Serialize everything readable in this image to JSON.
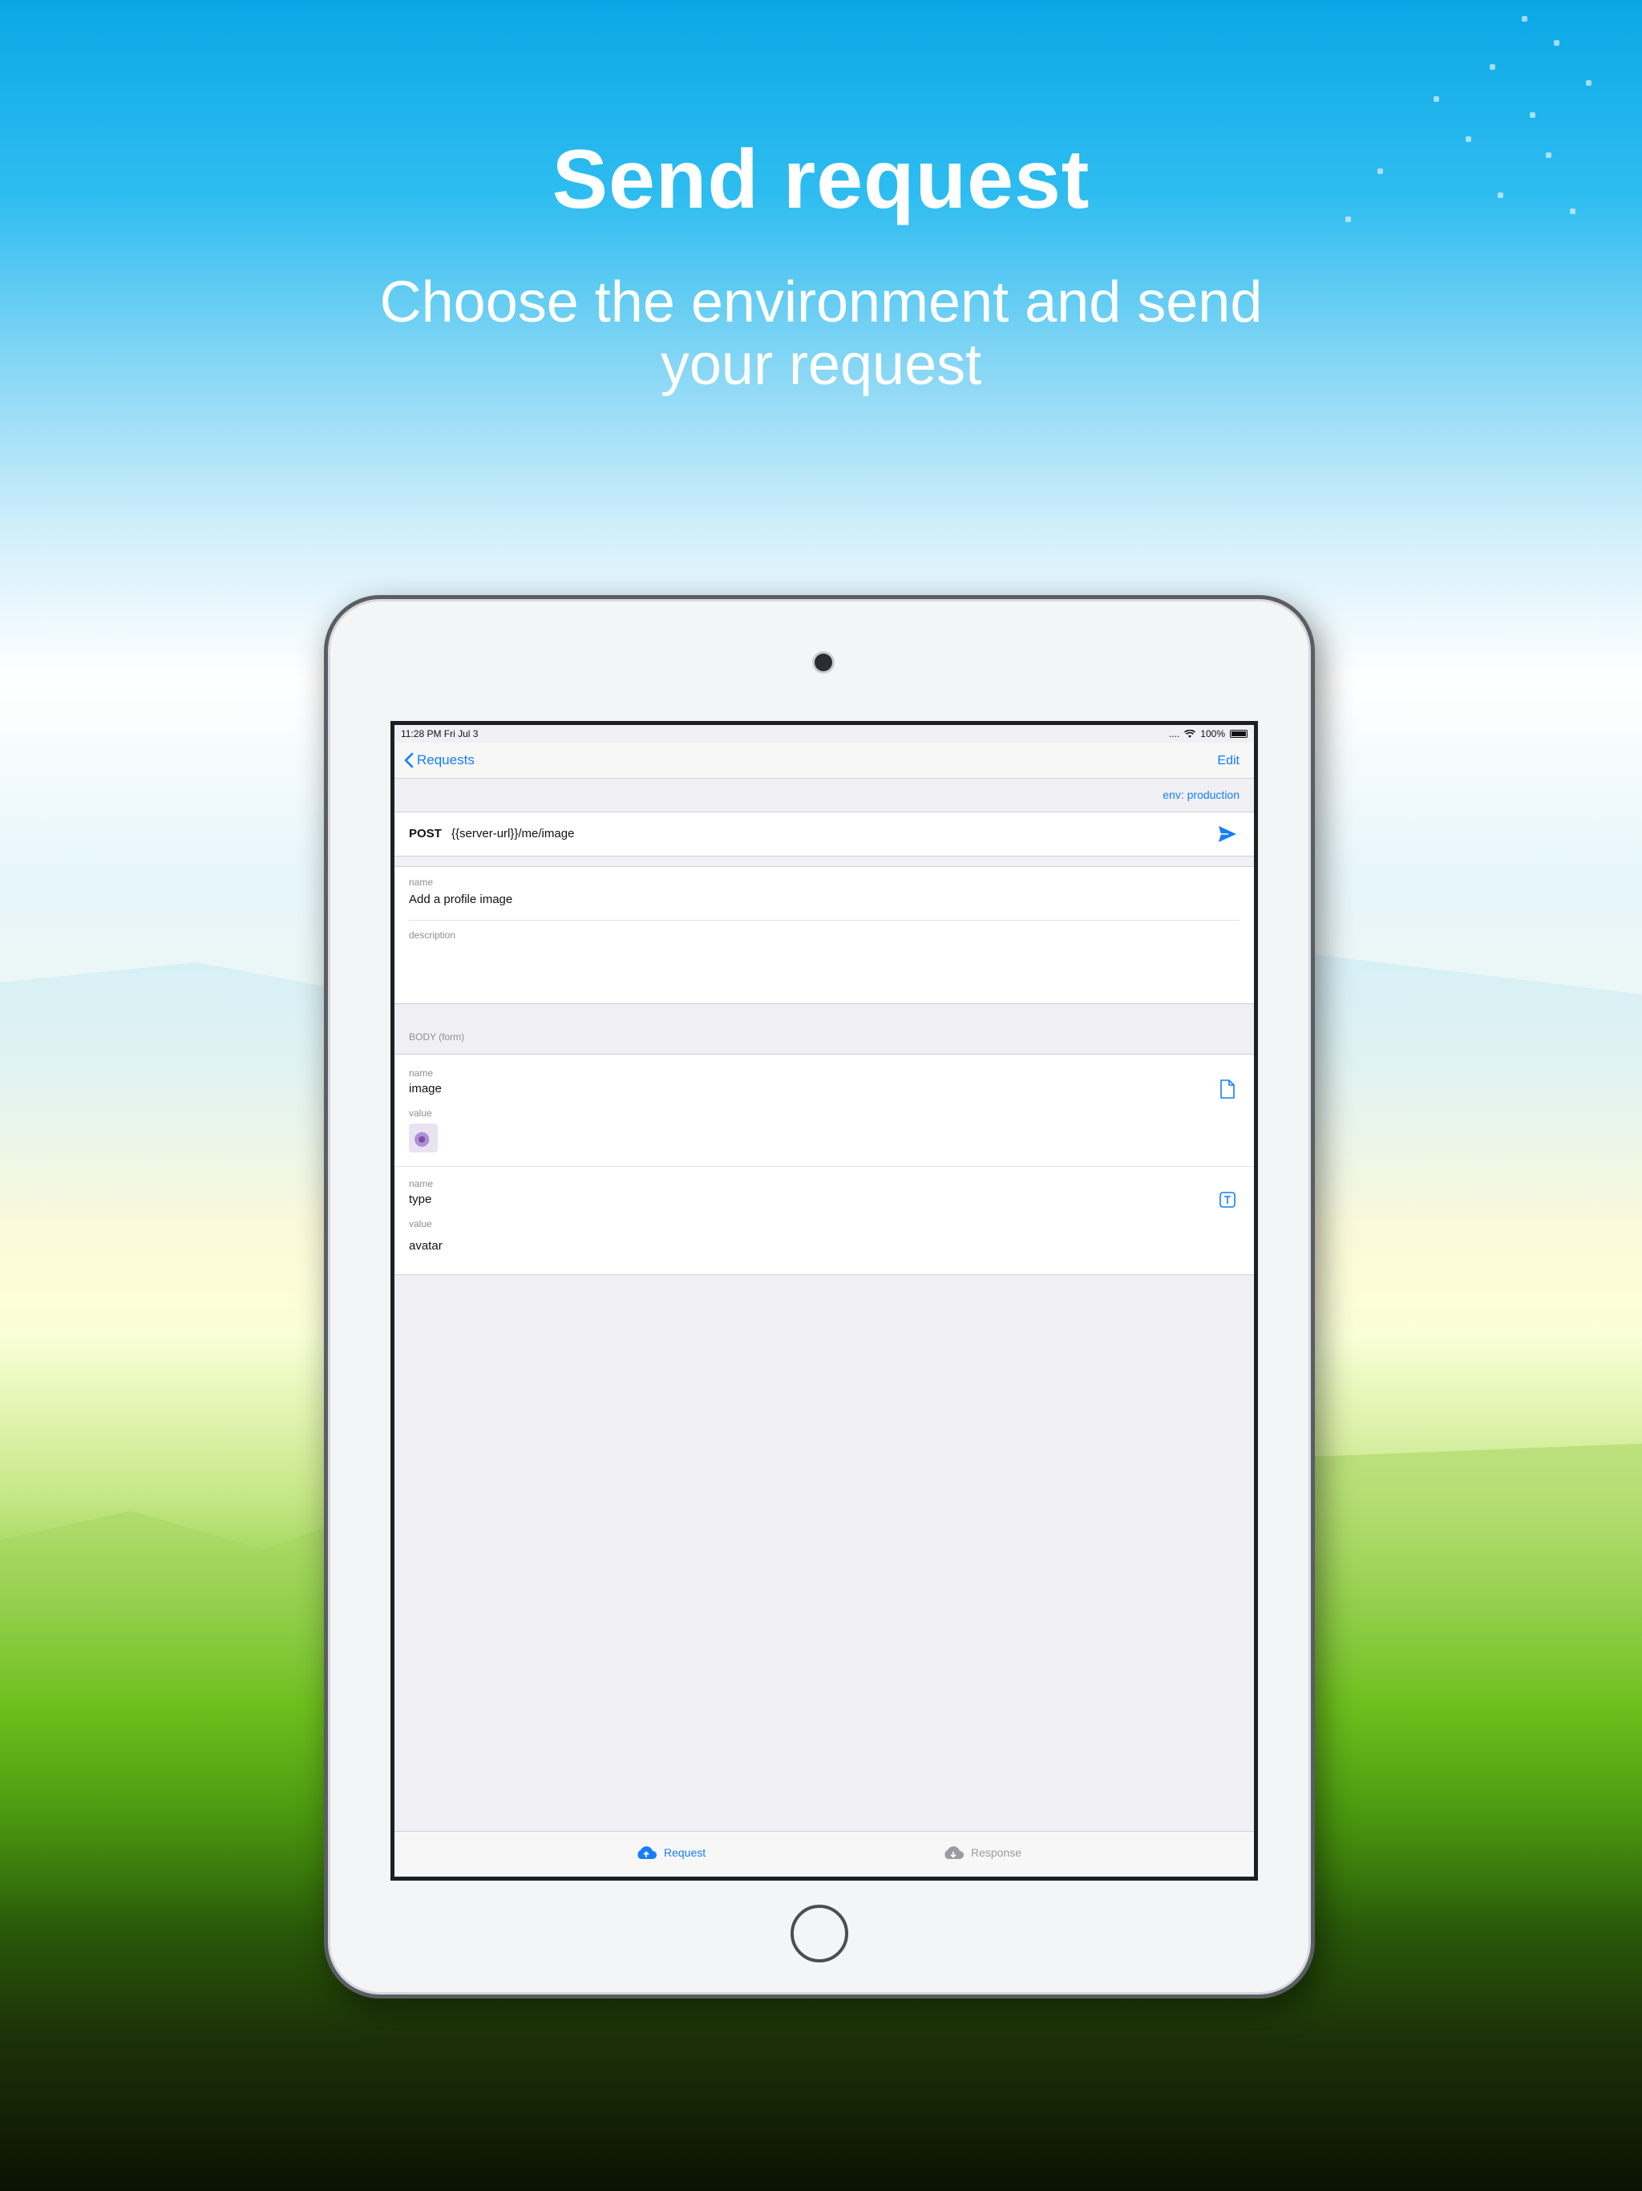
{
  "promo": {
    "headline": "Send request",
    "subline": "Choose the environment and send your request"
  },
  "status_bar": {
    "time": "11:28 PM   Fri Jul 3",
    "signal": "....",
    "battery": "100%"
  },
  "nav": {
    "back_label": "Requests",
    "edit_label": "Edit"
  },
  "environment": {
    "label": "env: production"
  },
  "request": {
    "method": "POST",
    "url": "{{server-url}}/me/image",
    "name_label": "name",
    "name_value": "Add a profile image",
    "description_label": "description"
  },
  "body": {
    "section_title": "BODY (form)",
    "fields": [
      {
        "name_label": "name",
        "name": "image",
        "value_label": "value",
        "kind": "file-icon"
      },
      {
        "name_label": "name",
        "name": "type",
        "value_label": "value",
        "value": "avatar",
        "kind": "text-icon"
      }
    ]
  },
  "tabs": {
    "request": "Request",
    "response": "Response"
  },
  "colors": {
    "accent": "#147efb",
    "inactive": "#9a9aa0"
  }
}
